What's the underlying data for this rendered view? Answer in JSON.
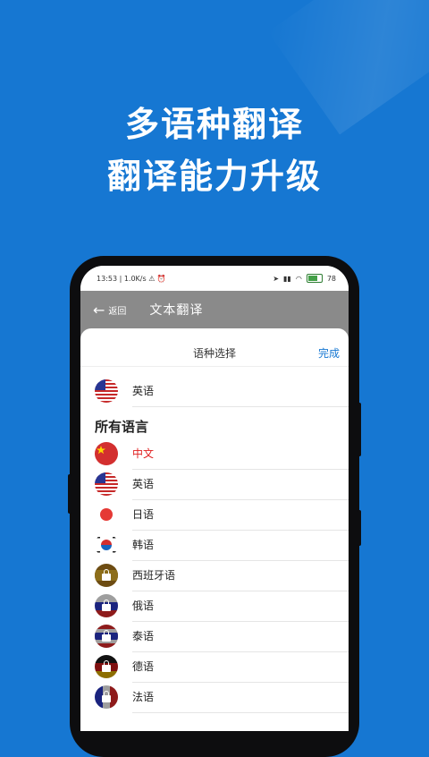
{
  "promo": {
    "line1": "多语种翻译",
    "line2": "翻译能力升级"
  },
  "statusbar": {
    "left": "13:53 | 1.0K/s ⚠ ⏰",
    "battery": "78"
  },
  "appbar": {
    "back_label": "返回",
    "title": "文本翻译"
  },
  "sheet": {
    "title": "语种选择",
    "done": "完成"
  },
  "recent": [
    {
      "name": "英语",
      "flag": "us-flag-icon"
    }
  ],
  "section_all": "所有语言",
  "languages": [
    {
      "name": "中文",
      "flag": "cn-flag-icon",
      "selected": true
    },
    {
      "name": "英语",
      "flag": "us-flag-icon"
    },
    {
      "name": "日语",
      "flag": "jp-flag-icon"
    },
    {
      "name": "韩语",
      "flag": "kr-flag-icon"
    },
    {
      "name": "西班牙语",
      "flag": "es-flag-icon",
      "locked": true
    },
    {
      "name": "俄语",
      "flag": "ru-flag-icon",
      "locked": true
    },
    {
      "name": "泰语",
      "flag": "th-flag-icon",
      "locked": true
    },
    {
      "name": "德语",
      "flag": "de-flag-icon",
      "locked": true
    },
    {
      "name": "法语",
      "flag": "fr-flag-icon",
      "locked": true
    }
  ]
}
